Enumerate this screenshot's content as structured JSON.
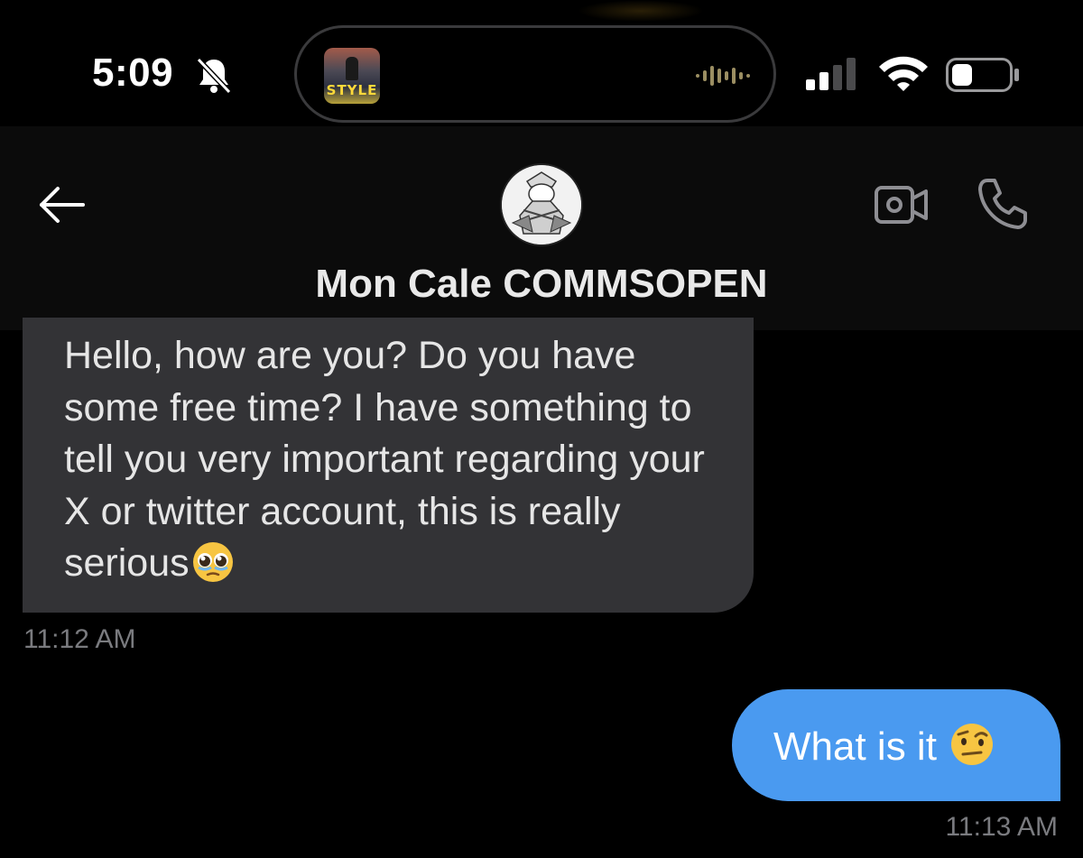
{
  "status_bar": {
    "time": "5:09",
    "silent_icon": "bell-slash-icon",
    "now_playing_art_text": "STYLE",
    "signal_bars": 2,
    "signal_bars_total": 4,
    "wifi_icon": "wifi-icon",
    "battery_level": 0.35
  },
  "header": {
    "back_icon": "arrow-left-icon",
    "avatar_icon": "profile-avatar",
    "contact_name": "Mon Cale COMMSOPEN",
    "video_call_icon": "video-camera-icon",
    "voice_call_icon": "phone-icon"
  },
  "messages": [
    {
      "direction": "incoming",
      "text": "Hello, how are you? Do you have some free time? I have something to tell you very important regarding your X or twitter account, this is really serious",
      "emoji": "pleading-face",
      "time": "11:12 AM"
    },
    {
      "direction": "outgoing",
      "text": "What is it",
      "emoji": "face-with-raised-eyebrow",
      "time": "11:13 AM"
    }
  ],
  "colors": {
    "background": "#000000",
    "incoming_bubble": "#333336",
    "outgoing_bubble": "#4a9af0",
    "timestamp": "#7a7b7f"
  }
}
